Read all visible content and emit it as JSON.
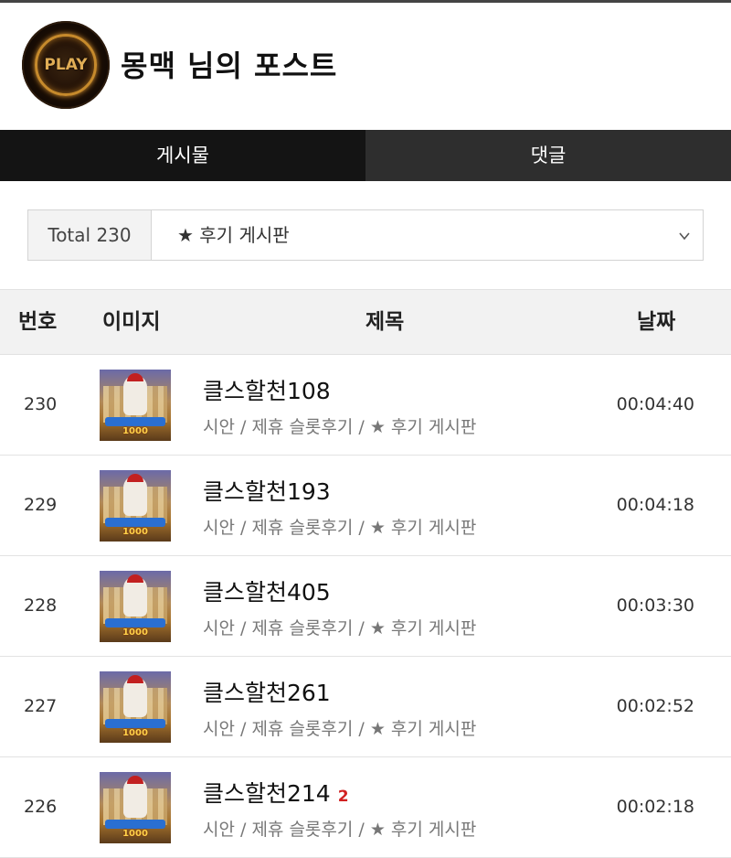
{
  "header": {
    "avatar_text": "PLAY",
    "title": "몽맥 님의 포스트"
  },
  "tabs": [
    {
      "label": "게시물",
      "active": true
    },
    {
      "label": "댓글",
      "active": false
    }
  ],
  "filter": {
    "total_label": "Total 230",
    "board_selected": "★ 후기 게시판"
  },
  "table": {
    "headers": {
      "num": "번호",
      "image": "이미지",
      "title": "제목",
      "date": "날짜"
    },
    "rows": [
      {
        "num": "230",
        "title": "클스할천108",
        "comments": "",
        "meta": "시안 / 제휴 슬롯후기 / ★ 후기 게시판",
        "date": "00:04:40",
        "thumb_label": "1000"
      },
      {
        "num": "229",
        "title": "클스할천193",
        "comments": "",
        "meta": "시안 / 제휴 슬롯후기 / ★ 후기 게시판",
        "date": "00:04:18",
        "thumb_label": "1000"
      },
      {
        "num": "228",
        "title": "클스할천405",
        "comments": "",
        "meta": "시안 / 제휴 슬롯후기 / ★ 후기 게시판",
        "date": "00:03:30",
        "thumb_label": "1000"
      },
      {
        "num": "227",
        "title": "클스할천261",
        "comments": "",
        "meta": "시안 / 제휴 슬롯후기 / ★ 후기 게시판",
        "date": "00:02:52",
        "thumb_label": "1000"
      },
      {
        "num": "226",
        "title": "클스할천214",
        "comments": "2",
        "meta": "시안 / 제휴 슬롯후기 / ★ 후기 게시판",
        "date": "00:02:18",
        "thumb_label": "1000"
      }
    ]
  },
  "colors": {
    "tab_active_bg": "#141414",
    "tab_inactive_bg": "#2e2e2e",
    "comment_count": "#d12020"
  }
}
